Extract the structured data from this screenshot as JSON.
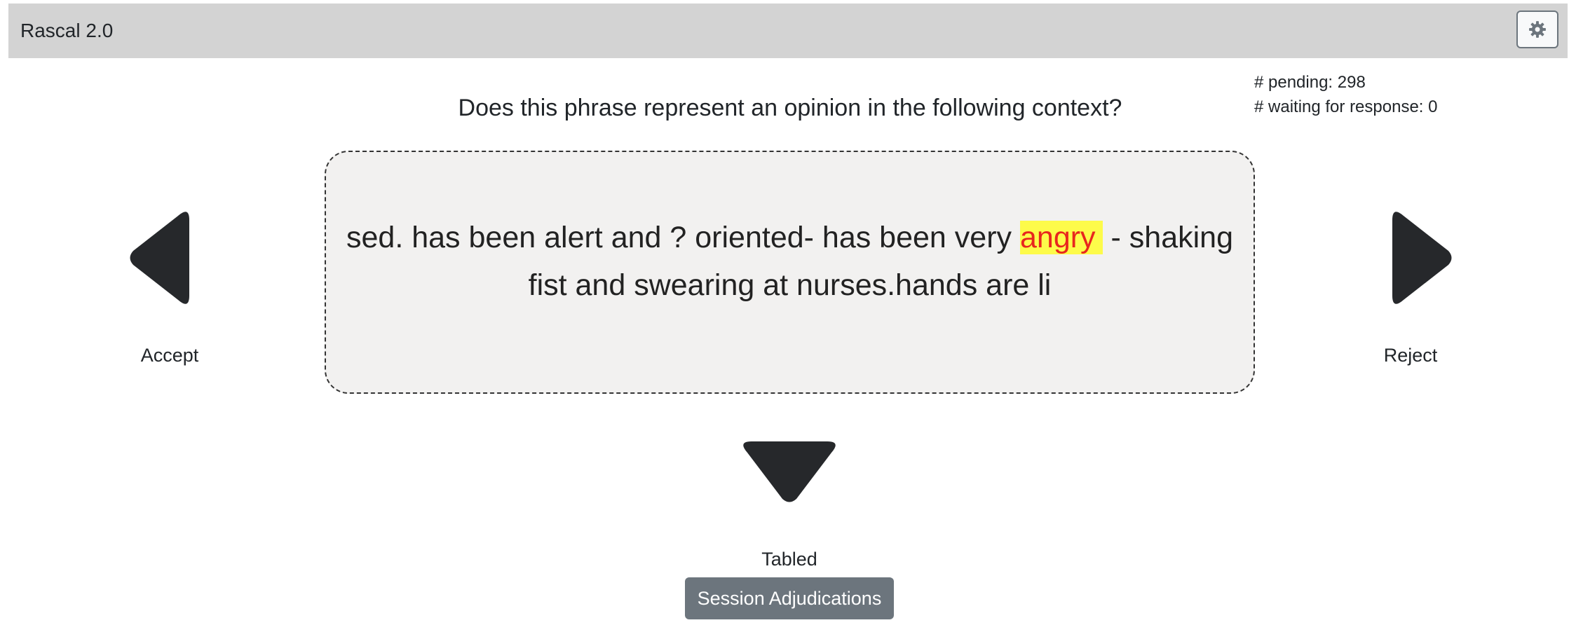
{
  "app": {
    "title": "Rascal 2.0",
    "settings_icon": "gear-icon"
  },
  "counters": {
    "pending": "# pending: 298",
    "waiting": "# waiting for response: 0"
  },
  "question": "Does this phrase represent an opinion in the following context?",
  "context": {
    "before": "sed. has been alert and ? oriented- has been very ",
    "highlight": "angry",
    "after": " - shaking fist and swearing at nurses.hands are li"
  },
  "actions": {
    "accept": {
      "label": "Accept",
      "icon": "arrow-left-icon"
    },
    "reject": {
      "label": "Reject",
      "icon": "arrow-right-icon"
    },
    "tabled": {
      "label": "Tabled",
      "icon": "arrow-down-icon"
    }
  },
  "session_button": "Session Adjudications",
  "colors": {
    "navbar": "#d3d3d3",
    "context_bg": "#f2f1f0",
    "highlight_bg": "#fdfb4a",
    "highlight_text": "#e8261e",
    "arrow": "#26282b",
    "session_button_bg": "#6c757d"
  }
}
